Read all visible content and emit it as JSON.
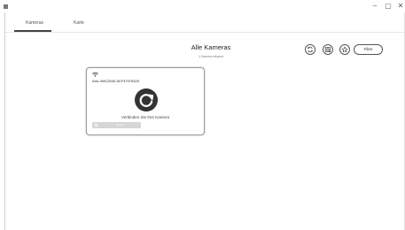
{
  "window": {
    "controls": {
      "minimize": "–",
      "maximize": "▢",
      "close": "✕"
    }
  },
  "tabs": [
    {
      "label": "Kameras",
      "active": true
    },
    {
      "label": "Karte",
      "active": false
    }
  ],
  "main": {
    "title": "Alle Kameras",
    "subtitle": "1 Kamera erkannt"
  },
  "toolbar": {
    "refresh_icon": "refresh-icon",
    "add_camera_icon": "camera-add-icon",
    "favorite_icon": "star-icon",
    "filter_label": "Filter"
  },
  "camera_card": {
    "signal_icon": "wifi-icon",
    "name": "Arlo-VMC2040-5CF37075320",
    "status_icon": "reconnect-icon",
    "message": "Verbinden Sie Ihre Kamera",
    "action_label": "Erneut"
  },
  "colors": {
    "accent": "#333333",
    "card_border": "#9a9a9a",
    "disabled_bar": "#d6d6d6"
  }
}
